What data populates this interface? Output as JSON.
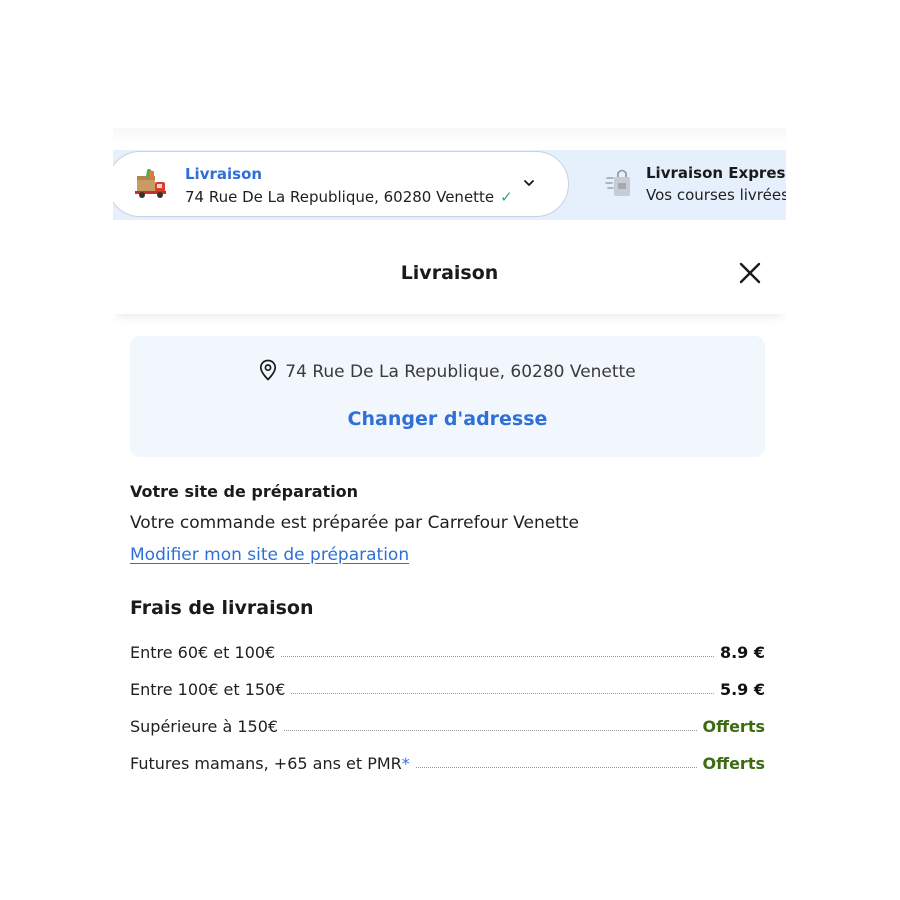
{
  "delivery_bar": {
    "mode_title": "Livraison",
    "address": "74 Rue De La Republique, 60280 Venette",
    "check": "✓",
    "express_title": "Livraison Express",
    "express_subtitle": "Vos courses livrées"
  },
  "modal": {
    "title": "Livraison",
    "close_glyph": "✕"
  },
  "address_box": {
    "address": "74 Rue De La Republique, 60280 Venette",
    "change_link": "Changer d'adresse"
  },
  "preparation": {
    "title": "Votre site de préparation",
    "text": "Votre commande est préparée par Carrefour Venette",
    "link": "Modifier mon site de préparation"
  },
  "fees": {
    "title": "Frais de livraison",
    "rows": [
      {
        "label": "Entre 60€ et 100€",
        "value": "8.9 €",
        "star": ""
      },
      {
        "label": "Entre 100€ et 150€",
        "value": "5.9 €",
        "star": ""
      },
      {
        "label": "Supérieure à 150€",
        "value": "Offerts",
        "star": ""
      },
      {
        "label": "Futures mamans, +65 ans et PMR",
        "value": "Offerts",
        "star": "*"
      }
    ]
  },
  "colors": {
    "accent": "#2f6fd6",
    "free": "#3d6b12",
    "check": "#3aa17e"
  }
}
